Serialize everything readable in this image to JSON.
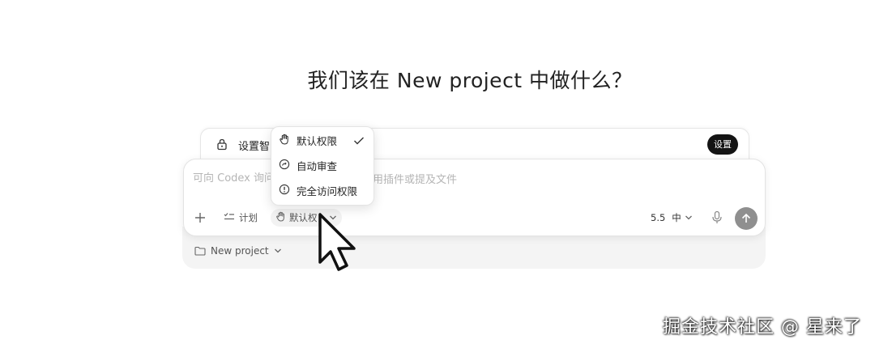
{
  "headline": "我们该在 New project 中做什么？",
  "banner": {
    "text": "设置智",
    "button_label": "设置"
  },
  "composer": {
    "placeholder": "可向 Codex 询问",
    "placeholder_tail": "用插件或提及文件",
    "plan_label": "计划",
    "permission_label": "默认权",
    "model_label": "5.5",
    "speed_label": "中"
  },
  "permission_menu": {
    "items": [
      {
        "label": "默认权限",
        "icon": "hand-icon",
        "checked": true
      },
      {
        "label": "自动审查",
        "icon": "auto-review-icon",
        "checked": false
      },
      {
        "label": "完全访问权限",
        "icon": "alert-circle-icon",
        "checked": false
      }
    ]
  },
  "project": {
    "label": "New project"
  },
  "watermark": "掘金技术社区 @ 星来了",
  "colors": {
    "send_button": "#8f8f8f",
    "banner_button": "#141414"
  }
}
